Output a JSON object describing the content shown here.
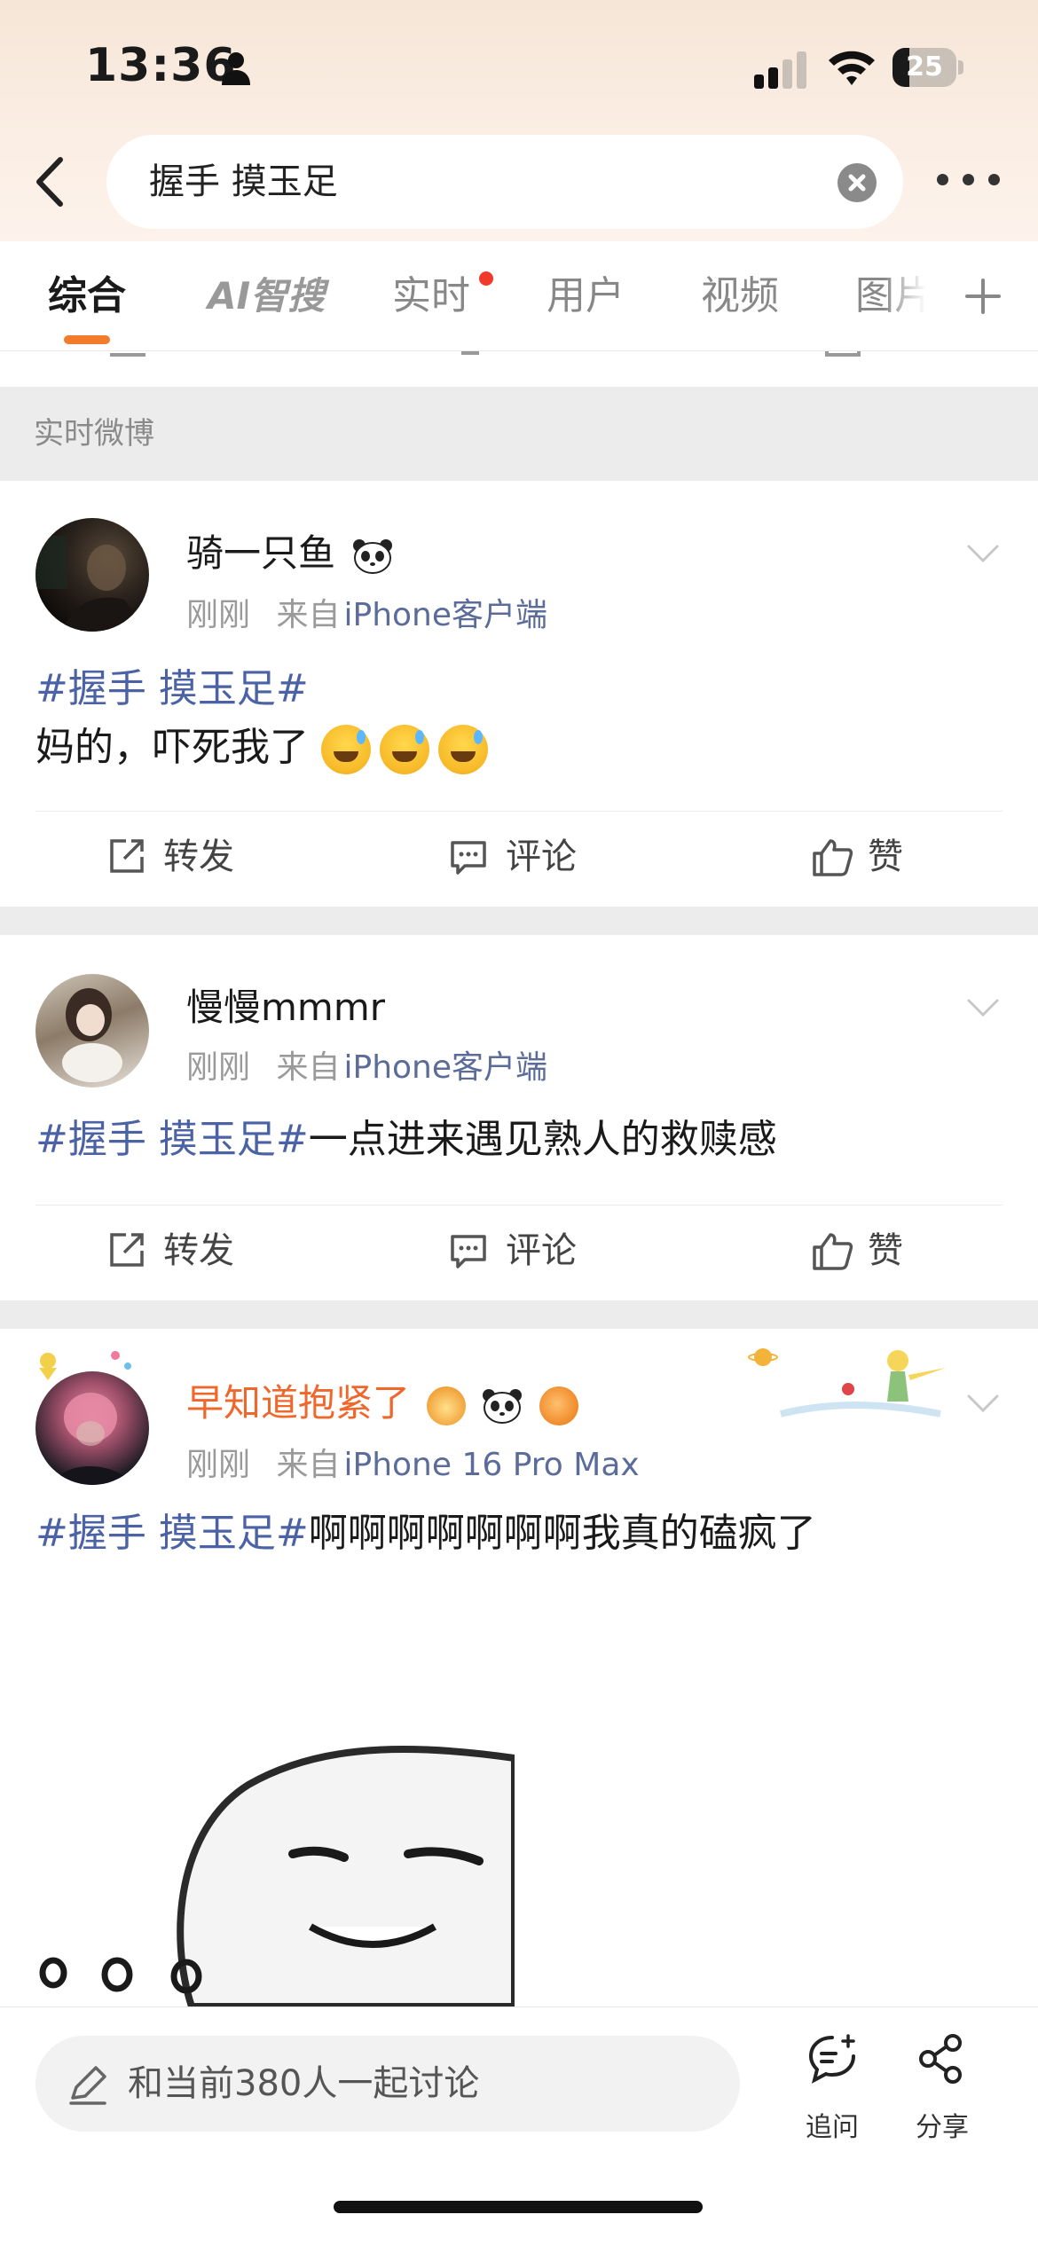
{
  "status_bar": {
    "time": "13:36",
    "battery": "25"
  },
  "search": {
    "query": "握手 摸玉足"
  },
  "tabs": [
    {
      "label": "综合"
    },
    {
      "label": "AI智搜"
    },
    {
      "label": "实时"
    },
    {
      "label": "用户"
    },
    {
      "label": "视频"
    },
    {
      "label": "图片"
    }
  ],
  "section": {
    "label": "实时微博"
  },
  "posts": [
    {
      "username": "骑一只鱼",
      "time": "刚刚",
      "via": "来自",
      "source": "iPhone客户端",
      "topic": "#握手 摸玉足#",
      "text": "妈的，吓死我了",
      "emoji_count": 3
    },
    {
      "username": "慢慢mmmr",
      "time": "刚刚",
      "via": "来自",
      "source": "iPhone客户端",
      "topic": "#握手 摸玉足#",
      "text": "一点进来遇见熟人的救赎感"
    },
    {
      "username": "早知道抱紧了",
      "time": "刚刚",
      "via": "来自",
      "source": "iPhone 16 Pro Max",
      "topic": "#握手 摸玉足#",
      "text": "啊啊啊啊啊啊啊我真的磕疯了"
    }
  ],
  "actions": {
    "repost": "转发",
    "comment": "评论",
    "like": "赞"
  },
  "bottom": {
    "discuss_placeholder": "和当前380人一起讨论",
    "follow_up": "追问",
    "share": "分享"
  },
  "colors": {
    "accent": "#f37b2c",
    "topic": "#4b62a5",
    "vip_name": "#f0672b"
  }
}
